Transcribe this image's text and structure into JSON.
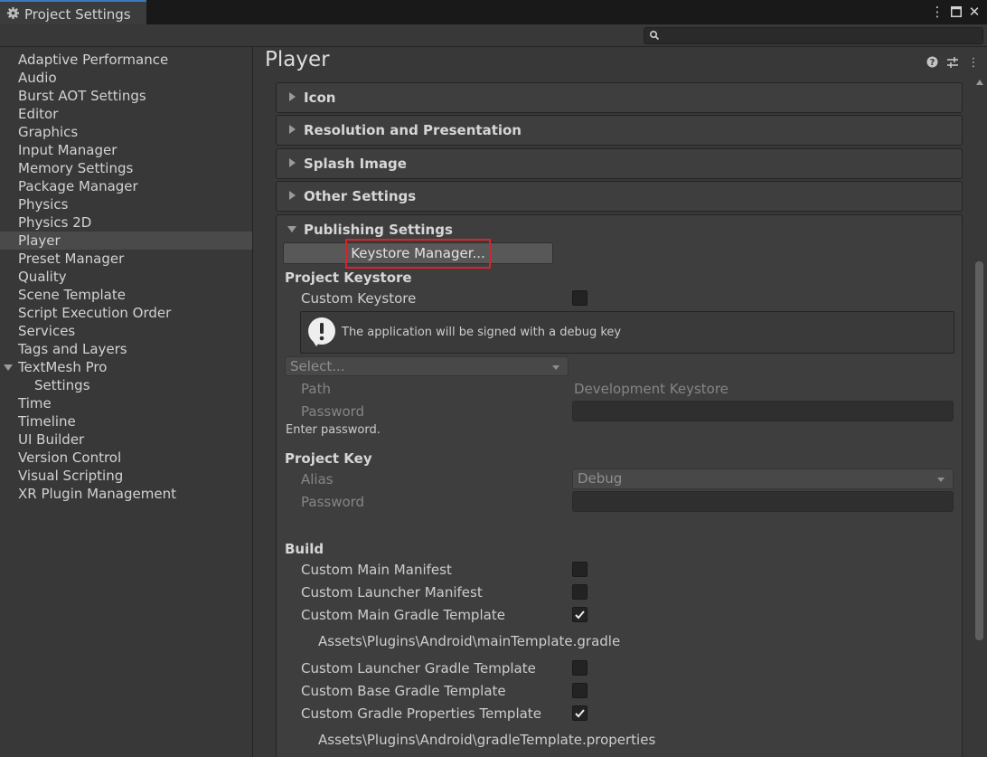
{
  "window": {
    "tab_title": "Project Settings",
    "search_placeholder": ""
  },
  "sidebar": {
    "items": [
      {
        "label": "Adaptive Performance"
      },
      {
        "label": "Audio"
      },
      {
        "label": "Burst AOT Settings"
      },
      {
        "label": "Editor"
      },
      {
        "label": "Graphics"
      },
      {
        "label": "Input Manager"
      },
      {
        "label": "Memory Settings"
      },
      {
        "label": "Package Manager"
      },
      {
        "label": "Physics"
      },
      {
        "label": "Physics 2D"
      },
      {
        "label": "Player",
        "selected": true
      },
      {
        "label": "Preset Manager"
      },
      {
        "label": "Quality"
      },
      {
        "label": "Scene Template"
      },
      {
        "label": "Script Execution Order"
      },
      {
        "label": "Services"
      },
      {
        "label": "Tags and Layers"
      },
      {
        "label": "TextMesh Pro",
        "expanded": true
      },
      {
        "label": "Settings",
        "child": true
      },
      {
        "label": "Time"
      },
      {
        "label": "Timeline"
      },
      {
        "label": "UI Builder"
      },
      {
        "label": "Version Control"
      },
      {
        "label": "Visual Scripting"
      },
      {
        "label": "XR Plugin Management"
      }
    ]
  },
  "main": {
    "title": "Player",
    "sections": [
      {
        "label": "Icon"
      },
      {
        "label": "Resolution and Presentation"
      },
      {
        "label": "Splash Image"
      },
      {
        "label": "Other Settings"
      }
    ],
    "publishing": {
      "header": "Publishing Settings",
      "keystore_manager_button": "Keystore Manager...",
      "project_keystore": {
        "heading": "Project Keystore",
        "custom_keystore_label": "Custom Keystore",
        "custom_keystore_checked": false,
        "info_message": "The application will be signed with a debug key",
        "select_placeholder": "Select...",
        "path_label": "Path",
        "path_value": "Development Keystore",
        "password_label": "Password",
        "password_hint": "Enter password."
      },
      "project_key": {
        "heading": "Project Key",
        "alias_label": "Alias",
        "alias_value": "Debug",
        "password_label": "Password"
      },
      "build": {
        "heading": "Build",
        "rows": [
          {
            "label": "Custom Main Manifest",
            "checked": false
          },
          {
            "label": "Custom Launcher Manifest",
            "checked": false
          },
          {
            "label": "Custom Main Gradle Template",
            "checked": true,
            "path": "Assets\\Plugins\\Android\\mainTemplate.gradle"
          },
          {
            "label": "Custom Launcher Gradle Template",
            "checked": false
          },
          {
            "label": "Custom Base Gradle Template",
            "checked": false
          },
          {
            "label": "Custom Gradle Properties Template",
            "checked": true,
            "path": "Assets\\Plugins\\Android\\gradleTemplate.properties"
          }
        ]
      }
    }
  },
  "colors": {
    "highlight": "#d9232b",
    "tab_accent": "#3a79bb",
    "selected_item": "#4a4a4a"
  }
}
